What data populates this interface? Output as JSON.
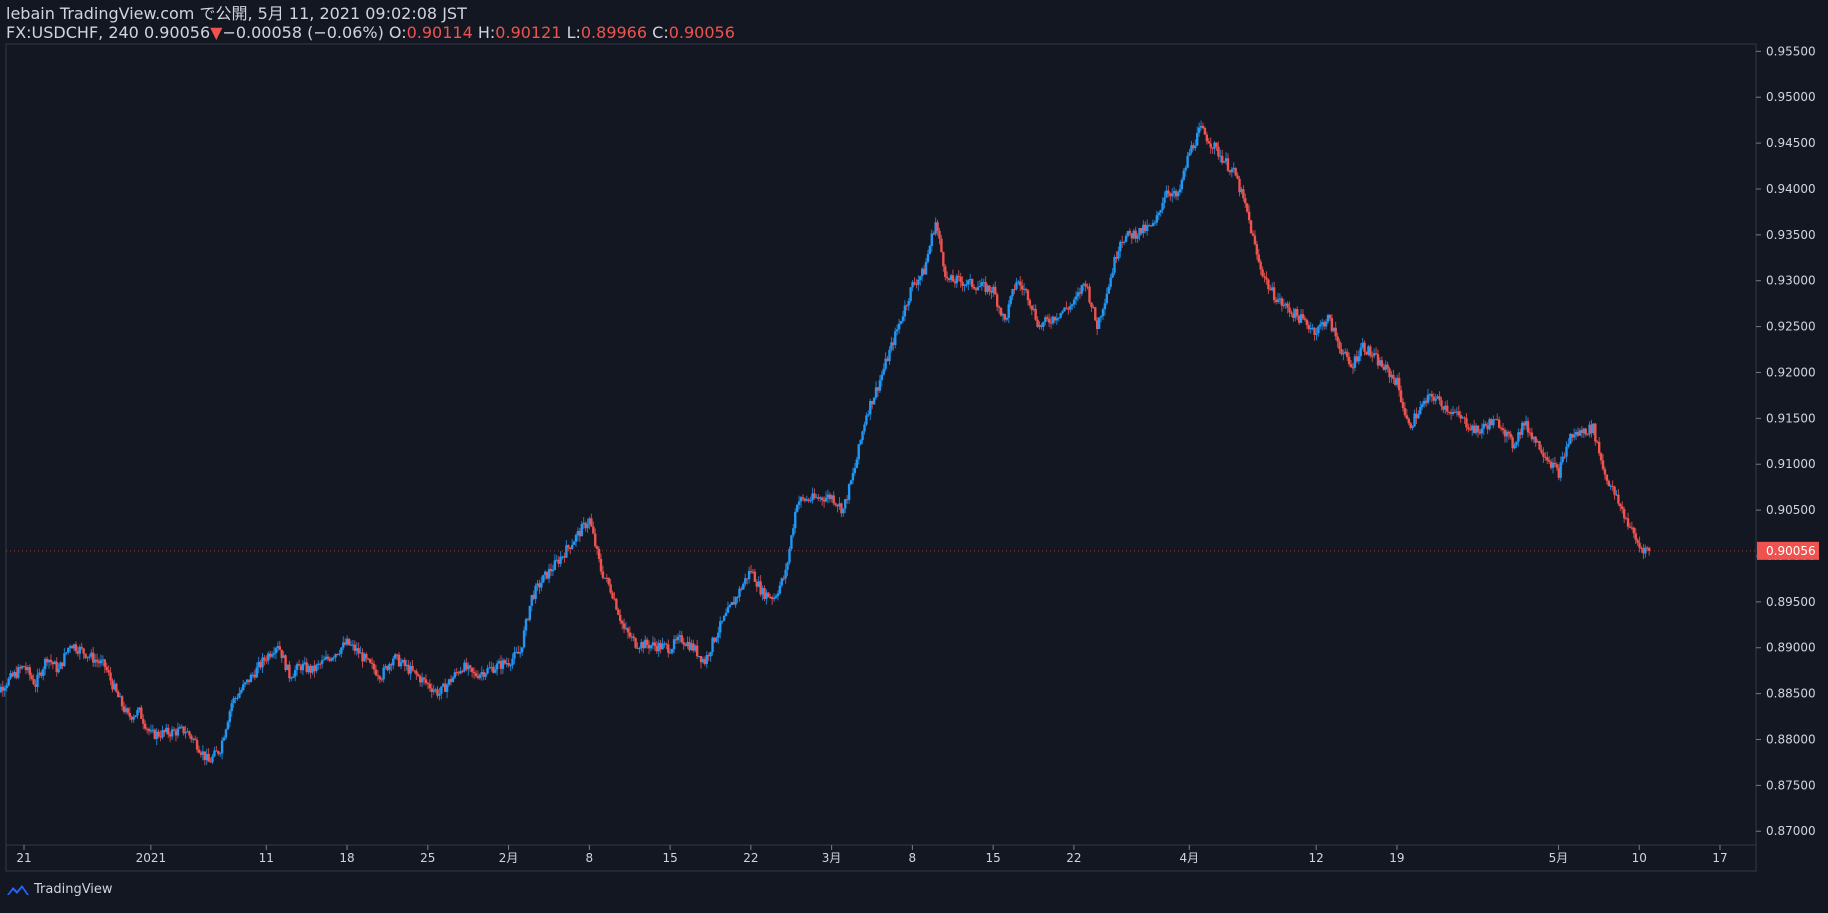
{
  "header": {
    "publish_line": "lebain TradingView.com で公開, 5月 11, 2021 09:02:08 JST",
    "symbol": "FX:USDCHF, 240",
    "last": "0.90056",
    "change_arrow": "▼",
    "change": "−0.00058 (−0.06%)",
    "o_label": "O:",
    "o_value": "0.90114",
    "h_label": "H:",
    "h_value": "0.90121",
    "l_label": "L:",
    "l_value": "0.89966",
    "c_label": "C:",
    "c_value": "0.90056"
  },
  "footer": {
    "brand": "TradingView",
    "logo_icon": "tradingview-logo-icon"
  },
  "colors": {
    "background": "#131722",
    "up": "#2962ff",
    "up_candle": "#2196f3",
    "down": "#ef5350",
    "grid": "#363a45",
    "text": "#d1d4dc",
    "price_tag": "#ef5350"
  },
  "chart_data": {
    "type": "candlestick",
    "title": "",
    "xlabel": "",
    "ylabel": "",
    "ylim": [
      0.8685,
      0.9558
    ],
    "y_ticks": [
      "0.95500",
      "0.95000",
      "0.94500",
      "0.94000",
      "0.93500",
      "0.93000",
      "0.92500",
      "0.92000",
      "0.91500",
      "0.91000",
      "0.90500",
      "0.90000",
      "0.89500",
      "0.89000",
      "0.88500",
      "0.88000",
      "0.87500",
      "0.87000"
    ],
    "y_tick_values": [
      0.955,
      0.95,
      0.945,
      0.94,
      0.935,
      0.93,
      0.925,
      0.92,
      0.915,
      0.91,
      0.905,
      0.9,
      0.895,
      0.89,
      0.885,
      0.88,
      0.875,
      0.87
    ],
    "x_ticks": [
      {
        "label": "21",
        "date": "2020-12-21"
      },
      {
        "label": "2021",
        "date": "2021-01-01"
      },
      {
        "label": "11",
        "date": "2021-01-11"
      },
      {
        "label": "18",
        "date": "2021-01-18"
      },
      {
        "label": "25",
        "date": "2021-01-25"
      },
      {
        "label": "2月",
        "date": "2021-02-01"
      },
      {
        "label": "8",
        "date": "2021-02-08"
      },
      {
        "label": "15",
        "date": "2021-02-15"
      },
      {
        "label": "22",
        "date": "2021-02-22"
      },
      {
        "label": "3月",
        "date": "2021-03-01"
      },
      {
        "label": "8",
        "date": "2021-03-08"
      },
      {
        "label": "15",
        "date": "2021-03-15"
      },
      {
        "label": "22",
        "date": "2021-03-22"
      },
      {
        "label": "4月",
        "date": "2021-04-01"
      },
      {
        "label": "12",
        "date": "2021-04-12"
      },
      {
        "label": "19",
        "date": "2021-04-19"
      },
      {
        "label": "5月",
        "date": "2021-05-03"
      },
      {
        "label": "10",
        "date": "2021-05-10"
      },
      {
        "label": "17",
        "date": "2021-05-17"
      }
    ],
    "last_price_label": "0.90056",
    "last_price": 0.90056,
    "series_path": [
      [
        "2020-12-18",
        0.8845
      ],
      [
        "2020-12-21",
        0.888
      ],
      [
        "2020-12-22",
        0.886
      ],
      [
        "2020-12-23",
        0.889
      ],
      [
        "2020-12-24",
        0.8875
      ],
      [
        "2020-12-25",
        0.8905
      ],
      [
        "2020-12-28",
        0.888
      ],
      [
        "2020-12-29",
        0.885
      ],
      [
        "2020-12-30",
        0.8825
      ],
      [
        "2020-12-31",
        0.883
      ],
      [
        "2021-01-01",
        0.8805
      ],
      [
        "2021-01-04",
        0.881
      ],
      [
        "2021-01-05",
        0.8795
      ],
      [
        "2021-01-06",
        0.8775
      ],
      [
        "2021-01-07",
        0.879
      ],
      [
        "2021-01-08",
        0.884
      ],
      [
        "2021-01-11",
        0.889
      ],
      [
        "2021-01-12",
        0.8905
      ],
      [
        "2021-01-13",
        0.887
      ],
      [
        "2021-01-14",
        0.888
      ],
      [
        "2021-01-15",
        0.8875
      ],
      [
        "2021-01-18",
        0.8905
      ],
      [
        "2021-01-19",
        0.8895
      ],
      [
        "2021-01-20",
        0.888
      ],
      [
        "2021-01-21",
        0.887
      ],
      [
        "2021-01-22",
        0.889
      ],
      [
        "2021-01-25",
        0.886
      ],
      [
        "2021-01-26",
        0.885
      ],
      [
        "2021-01-27",
        0.8865
      ],
      [
        "2021-01-28",
        0.888
      ],
      [
        "2021-01-29",
        0.887
      ],
      [
        "2021-02-01",
        0.8885
      ],
      [
        "2021-02-02",
        0.8895
      ],
      [
        "2021-02-03",
        0.8955
      ],
      [
        "2021-02-04",
        0.8975
      ],
      [
        "2021-02-05",
        0.899
      ],
      [
        "2021-02-08",
        0.904
      ],
      [
        "2021-02-09",
        0.8985
      ],
      [
        "2021-02-10",
        0.896
      ],
      [
        "2021-02-11",
        0.892
      ],
      [
        "2021-02-12",
        0.8905
      ],
      [
        "2021-02-15",
        0.89
      ],
      [
        "2021-02-16",
        0.891
      ],
      [
        "2021-02-17",
        0.89
      ],
      [
        "2021-02-18",
        0.8885
      ],
      [
        "2021-02-19",
        0.8915
      ],
      [
        "2021-02-22",
        0.8985
      ],
      [
        "2021-02-23",
        0.896
      ],
      [
        "2021-02-24",
        0.8955
      ],
      [
        "2021-02-25",
        0.898
      ],
      [
        "2021-02-26",
        0.906
      ],
      [
        "2021-03-01",
        0.9065
      ],
      [
        "2021-03-02",
        0.905
      ],
      [
        "2021-03-03",
        0.9095
      ],
      [
        "2021-03-04",
        0.9155
      ],
      [
        "2021-03-05",
        0.9185
      ],
      [
        "2021-03-08",
        0.9295
      ],
      [
        "2021-03-09",
        0.931
      ],
      [
        "2021-03-10",
        0.9365
      ],
      [
        "2021-03-11",
        0.93
      ],
      [
        "2021-03-12",
        0.93
      ],
      [
        "2021-03-15",
        0.929
      ],
      [
        "2021-03-16",
        0.9255
      ],
      [
        "2021-03-17",
        0.93
      ],
      [
        "2021-03-18",
        0.9285
      ],
      [
        "2021-03-19",
        0.925
      ],
      [
        "2021-03-22",
        0.9275
      ],
      [
        "2021-03-23",
        0.93
      ],
      [
        "2021-03-24",
        0.925
      ],
      [
        "2021-03-25",
        0.9295
      ],
      [
        "2021-03-26",
        0.9345
      ],
      [
        "2021-03-29",
        0.936
      ],
      [
        "2021-03-30",
        0.94
      ],
      [
        "2021-03-31",
        0.939
      ],
      [
        "2021-04-01",
        0.944
      ],
      [
        "2021-04-02",
        0.9465
      ],
      [
        "2021-04-05",
        0.9415
      ],
      [
        "2021-04-06",
        0.9375
      ],
      [
        "2021-04-07",
        0.932
      ],
      [
        "2021-04-08",
        0.929
      ],
      [
        "2021-04-09",
        0.9275
      ],
      [
        "2021-04-12",
        0.9245
      ],
      [
        "2021-04-13",
        0.926
      ],
      [
        "2021-04-14",
        0.923
      ],
      [
        "2021-04-15",
        0.9205
      ],
      [
        "2021-04-16",
        0.923
      ],
      [
        "2021-04-19",
        0.919
      ],
      [
        "2021-04-20",
        0.914
      ],
      [
        "2021-04-21",
        0.916
      ],
      [
        "2021-04-22",
        0.9175
      ],
      [
        "2021-04-23",
        0.9165
      ],
      [
        "2021-04-26",
        0.9135
      ],
      [
        "2021-04-27",
        0.9145
      ],
      [
        "2021-04-28",
        0.9145
      ],
      [
        "2021-04-29",
        0.912
      ],
      [
        "2021-04-30",
        0.9145
      ],
      [
        "2021-05-03",
        0.909
      ],
      [
        "2021-05-04",
        0.913
      ],
      [
        "2021-05-05",
        0.9135
      ],
      [
        "2021-05-06",
        0.914
      ],
      [
        "2021-05-07",
        0.909
      ],
      [
        "2021-05-10",
        0.901
      ],
      [
        "2021-05-11",
        0.90056
      ]
    ]
  }
}
